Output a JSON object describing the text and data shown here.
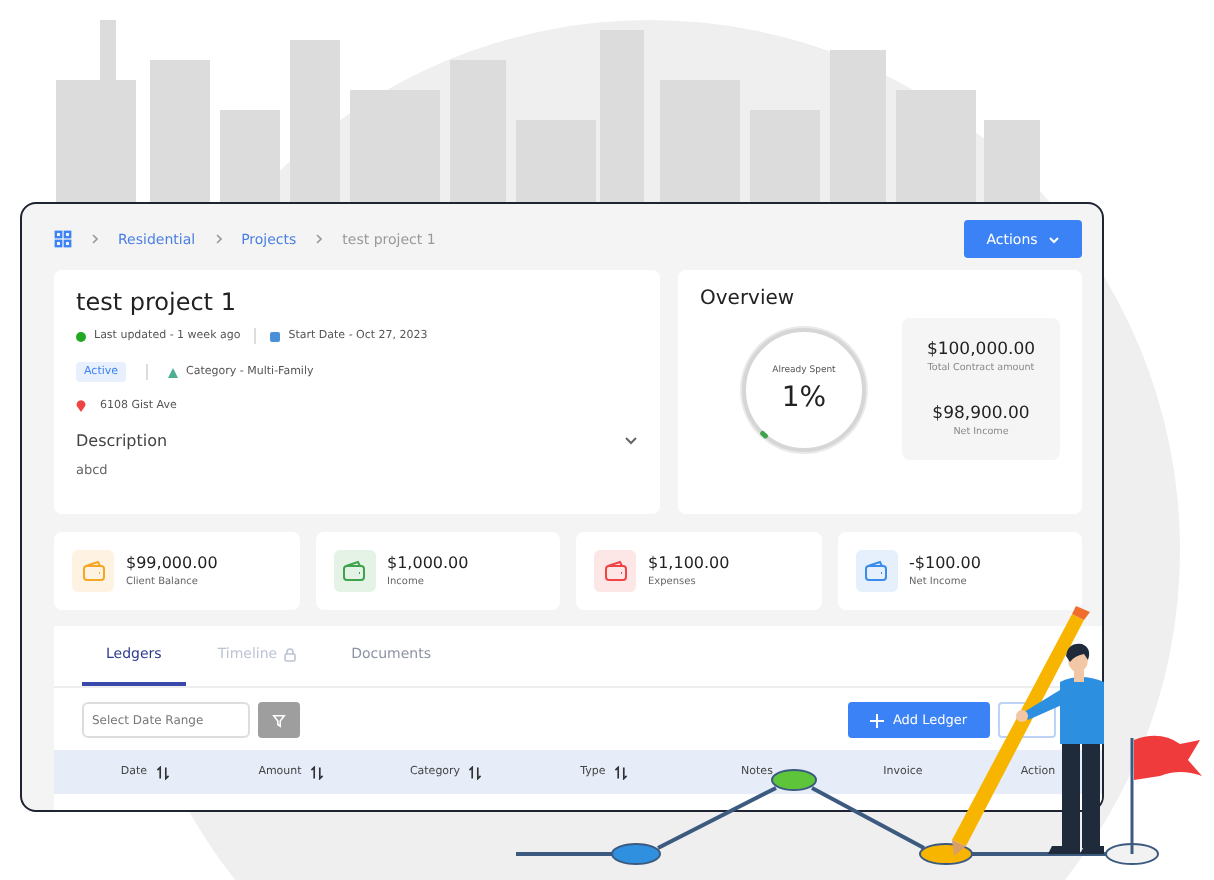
{
  "breadcrumb": [
    {
      "label": "Residential",
      "kind": "link"
    },
    {
      "label": "Projects",
      "kind": "link"
    },
    {
      "label": "test project 1",
      "kind": "current"
    }
  ],
  "actions_button": "Actions",
  "project": {
    "title": "test project 1",
    "last_updated": "Last updated - 1 week ago",
    "start_date": "Start Date - Oct 27, 2023",
    "status": "Active",
    "category": "Category - Multi-Family",
    "address": "6108 Gist Ave",
    "description_label": "Description",
    "description": "abcd"
  },
  "overview": {
    "title": "Overview",
    "gauge_label": "Already Spent",
    "gauge_value": "1%",
    "level": 0.01,
    "total_amount": "$100,000.00",
    "total_label": "Total Contract amount",
    "net_amount": "$98,900.00",
    "net_label": "Net Income"
  },
  "stats": [
    {
      "value": "$99,000.00",
      "label": "Client Balance",
      "color": "#f5a623"
    },
    {
      "value": "$1,000.00",
      "label": "Income",
      "color": "#3fa34d"
    },
    {
      "value": "$1,100.00",
      "label": "Expenses",
      "color": "#ef4444"
    },
    {
      "value": "-$100.00",
      "label": "Net Income",
      "color": "#3b8beb"
    }
  ],
  "tabs": [
    {
      "label": "Ledgers",
      "selected": true,
      "locked": false
    },
    {
      "label": "Timeline",
      "selected": false,
      "locked": true
    },
    {
      "label": "Documents",
      "selected": false,
      "locked": false
    }
  ],
  "date_range": {
    "placeholder": "Select Date Range"
  },
  "add_button": "Add Ledger",
  "table": {
    "columns": [
      {
        "label": "Date",
        "sortable": true
      },
      {
        "label": "Amount",
        "sortable": true
      },
      {
        "label": "Category",
        "sortable": true
      },
      {
        "label": "Type",
        "sortable": true
      },
      {
        "label": "Notes",
        "sortable": false
      },
      {
        "label": "Invoice",
        "sortable": false
      },
      {
        "label": "Action",
        "sortable": false
      }
    ]
  }
}
